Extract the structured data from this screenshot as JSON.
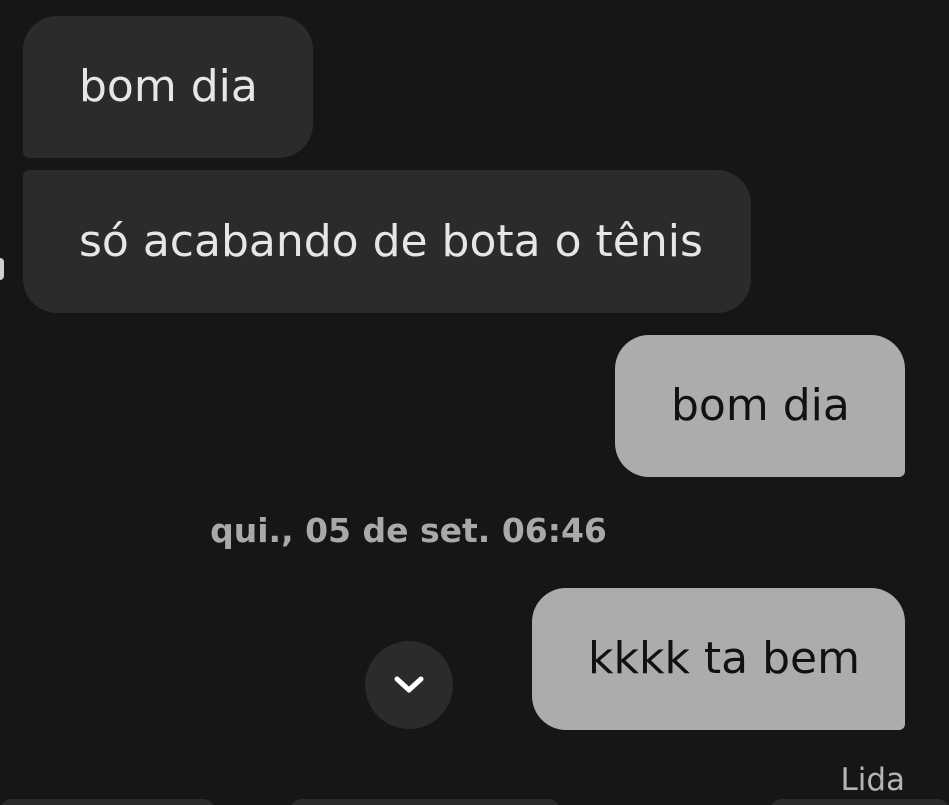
{
  "messages": [
    {
      "direction": "incoming",
      "text": "bom dia"
    },
    {
      "direction": "incoming",
      "text": "só acabando de bota o tênis"
    },
    {
      "direction": "outgoing",
      "text": "bom dia"
    },
    {
      "direction": "outgoing",
      "text": "kkkk ta bem"
    }
  ],
  "timestamp": "qui., 05 de set. 06:46",
  "read_status": "Lida",
  "scroll_button": {
    "icon": "chevron-down-icon"
  },
  "colors": {
    "background": "#161616",
    "incoming_bubble": "#2b2b2b",
    "incoming_text": "#e6e6e6",
    "outgoing_bubble": "#acacac",
    "outgoing_text": "#111111",
    "timestamp_text": "#a9a9a9"
  }
}
